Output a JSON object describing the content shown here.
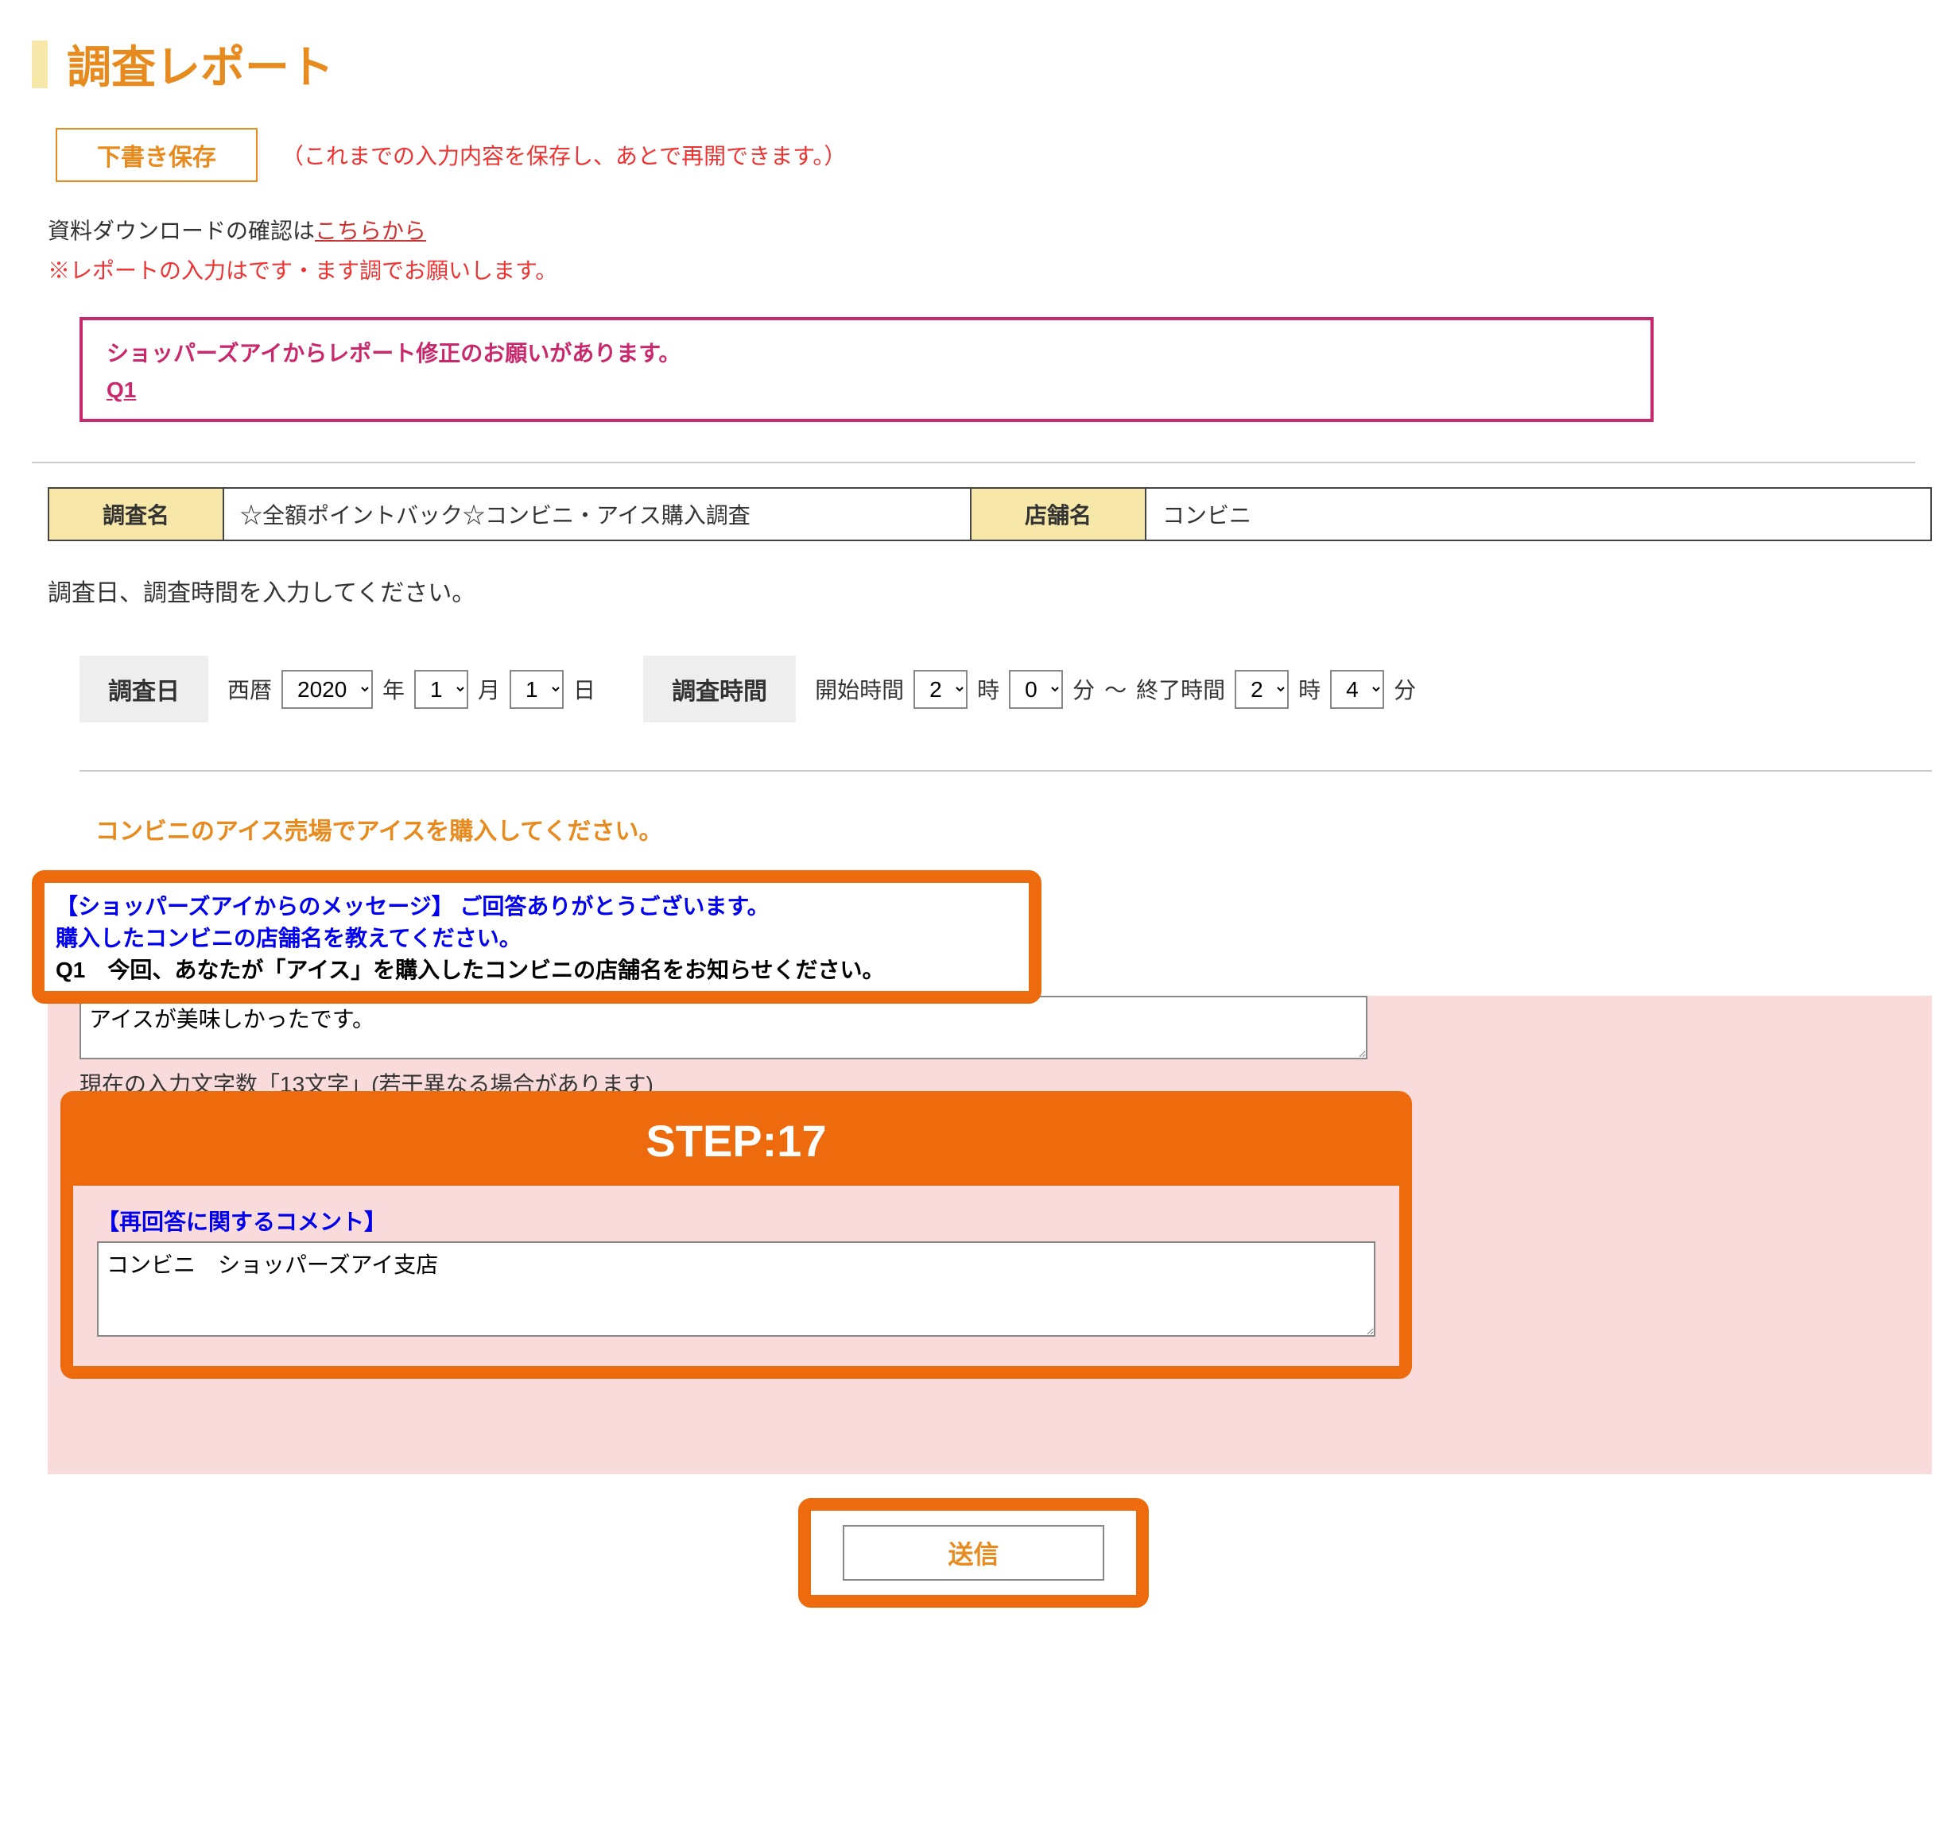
{
  "title": "調査レポート",
  "draft": {
    "button": "下書き保存",
    "help": "（これまでの入力内容を保存し、あとで再開できます。）"
  },
  "download": {
    "prefix": "資料ダウンロードの確認は",
    "link": "こちらから"
  },
  "notice": "※レポートの入力はです・ます調でお願いします。",
  "correction": {
    "message": "ショッパーズアイからレポート修正のお願いがあります。",
    "link": "Q1"
  },
  "info": {
    "survey_label": "調査名",
    "survey_value": "☆全額ポイントバック☆コンビニ・アイス購入調査",
    "store_label": "店舗名",
    "store_value": "コンビニ"
  },
  "date_section": {
    "instruction": "調査日、調査時間を入力してください。",
    "date_label": "調査日",
    "seireki": "西暦",
    "year": "2020",
    "year_suffix": "年",
    "month": "1",
    "month_suffix": "月",
    "day": "1",
    "day_suffix": "日",
    "time_label": "調査時間",
    "start_label": "開始時間",
    "sh": "2",
    "h_suffix": "時",
    "sm": "0",
    "m_suffix": "分",
    "to": " ～ ",
    "end_label": "終了時間",
    "eh": "2",
    "em": "4"
  },
  "q_section": {
    "title": "コンビニのアイス売場でアイスを購入してください。",
    "msg_line1": "【ショッパーズアイからのメッセージ】 ご回答ありがとうございます。",
    "msg_line2": "購入したコンビニの店舗名を教えてください。",
    "q_text": "Q1　今回、あなたが「アイス」を購入したコンビニの店舗名をお知らせください。",
    "answer_value": "アイスが美味しかったです。",
    "char_count": "現在の入力文字数「13文字」(若干異なる場合があります)"
  },
  "step": {
    "label": "STEP:17",
    "re_label": "【再回答に関するコメント】",
    "re_value": "コンビニ　ショッパーズアイ支店"
  },
  "submit": "送信"
}
